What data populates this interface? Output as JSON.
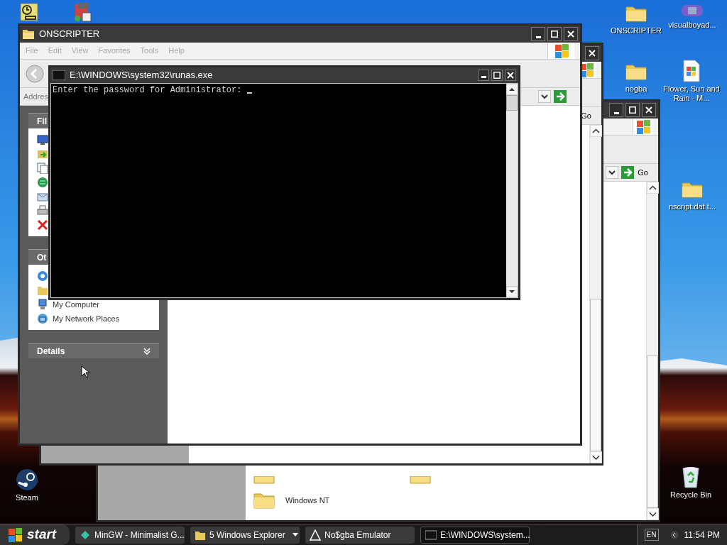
{
  "desktop": {
    "icons": [
      {
        "kind": "clock"
      },
      {
        "kind": "program"
      },
      {
        "kind": "folder",
        "label": "ONSCRIPTER"
      },
      {
        "kind": "gameboy",
        "label": "visualboyad..."
      },
      {
        "kind": "folder",
        "label": "nogba"
      },
      {
        "kind": "document",
        "label": "Flower, Sun and Rain - M..."
      },
      {
        "kind": "folder",
        "label": "nscript.dat t..."
      },
      {
        "kind": "steam",
        "label": "Steam"
      },
      {
        "kind": "recycle",
        "label": "Recycle Bin"
      }
    ]
  },
  "windows": [
    {
      "kind": "explorer",
      "go_label": "Go",
      "folders": [
        {
          "kind": "partial"
        },
        {
          "kind": "partial"
        },
        {
          "kind": "folder",
          "label": "Windows NT"
        }
      ]
    },
    {
      "kind": "explorer",
      "go_label": "Go"
    },
    {
      "kind": "explorer",
      "title": "ONSCRIPTER",
      "menu": [
        "File",
        "Edit",
        "View",
        "Favorites",
        "Tools",
        "Help"
      ],
      "address_label": "Addres",
      "panel": [
        {
          "title": "Fil",
          "items": [
            {
              "kind": "icon"
            },
            {
              "kind": "icon"
            },
            {
              "kind": "icon"
            },
            {
              "kind": "icon"
            },
            {
              "kind": "icon"
            },
            {
              "kind": "icon"
            },
            {
              "kind": "icon"
            }
          ]
        },
        {
          "title": "Ot",
          "items": [
            {
              "kind": "icon"
            },
            {
              "kind": "icon"
            },
            {
              "kind": "link",
              "label": "My Computer"
            },
            {
              "kind": "link",
              "label": "My Network Places"
            }
          ]
        },
        {
          "title": "Details",
          "expanded": false
        }
      ]
    },
    {
      "kind": "console",
      "title": "E:\\WINDOWS\\system32\\runas.exe",
      "text": "Enter the password for Administrator: "
    }
  ],
  "taskbar": {
    "start": "start",
    "tasks": [
      {
        "kind": "mingw",
        "label": "MinGW - Minimalist G...",
        "selected": false
      },
      {
        "kind": "folder_group",
        "label": "5 Windows Explorer",
        "selected": false
      },
      {
        "kind": "nogba",
        "label": "No$gba Emulator",
        "selected": false
      },
      {
        "kind": "console",
        "label": "E:\\WINDOWS\\system...",
        "selected": true
      }
    ],
    "language": "EN",
    "clock": "11:54 PM"
  }
}
